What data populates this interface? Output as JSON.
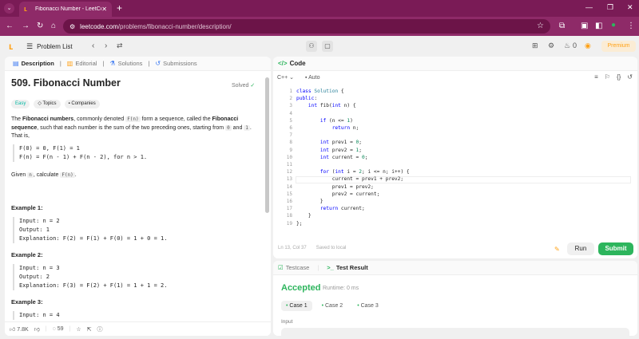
{
  "browser": {
    "tab_title": "Fibonacci Number - LeetCode",
    "url_host": "leetcode.com",
    "url_path": "/problems/fibonacci-number/description/"
  },
  "nav": {
    "problem_list": "Problem List",
    "streak": "0",
    "premium": "Premium"
  },
  "left_tabs": [
    "Description",
    "Editorial",
    "Solutions",
    "Submissions"
  ],
  "problem": {
    "title": "509. Fibonacci Number",
    "status": "Solved",
    "tags": [
      "Easy",
      "Topics",
      "Companies"
    ],
    "desc_p1_a": "The ",
    "desc_p1_b": "Fibonacci numbers",
    "desc_p1_c": ", commonly denoted ",
    "desc_p1_d": "F(n)",
    "desc_p1_e": " form a sequence, called the ",
    "desc_p1_f": "Fibonacci sequence",
    "desc_p1_g": ", such that each number is the sum of the two preceding ones, starting from ",
    "desc_p1_h": "0",
    "desc_p1_i": " and ",
    "desc_p1_j": "1",
    "desc_p1_k": ". That is,",
    "formula": "F(0) = 0, F(1) = 1\nF(n) = F(n - 1) + F(n - 2), for n > 1.",
    "given_a": "Given ",
    "given_b": "n",
    "given_c": ", calculate ",
    "given_d": "F(n)",
    "given_e": ".",
    "examples": [
      {
        "title": "Example 1:",
        "body": "Input: n = 2\nOutput: 1\nExplanation: F(2) = F(1) + F(0) = 1 + 0 = 1."
      },
      {
        "title": "Example 2:",
        "body": "Input: n = 3\nOutput: 2\nExplanation: F(3) = F(2) + F(1) = 1 + 1 = 2."
      },
      {
        "title": "Example 3:",
        "body": "Input: n = 4"
      }
    ]
  },
  "footer": {
    "likes": "7.8K",
    "comments": "59"
  },
  "code": {
    "title": "Code",
    "language": "C++",
    "mode": "Auto",
    "status_pos": "Ln 13, Col 37",
    "status_saved": "Saved to local",
    "run": "Run",
    "submit": "Submit"
  },
  "result": {
    "tabs": [
      "Testcase",
      "Test Result"
    ],
    "verdict": "Accepted",
    "runtime": "Runtime: 0 ms",
    "cases": [
      "Case 1",
      "Case 2",
      "Case 3"
    ],
    "input_label": "Input"
  }
}
